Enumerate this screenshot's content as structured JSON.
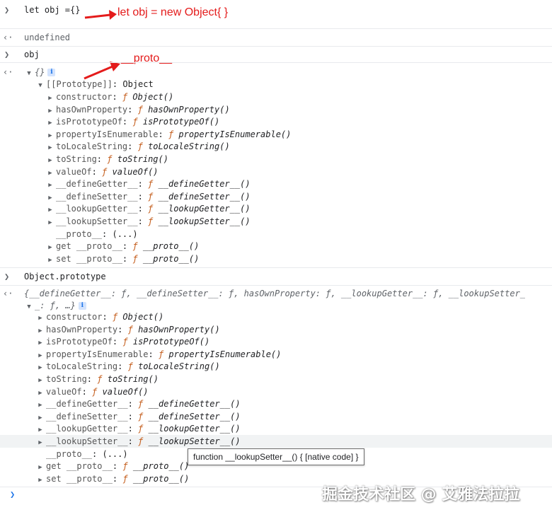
{
  "console": {
    "cmd1": "let obj ={}",
    "out1": "undefined",
    "cmd2": "obj",
    "obj_preview": "{}",
    "proto_key": "[[Prototype]]",
    "proto_val": "Object",
    "cmd3": "Object.prototype",
    "obj_proto_preview_a": "{__defineGetter__: ƒ, __defineSetter__: ƒ, hasOwnProperty: ƒ, __lookupGetter__: ƒ, __lookupSetter_",
    "obj_proto_preview_b": "_: ƒ, …}",
    "props": [
      {
        "key": "constructor",
        "fn": "Object()"
      },
      {
        "key": "hasOwnProperty",
        "fn": "hasOwnProperty()"
      },
      {
        "key": "isPrototypeOf",
        "fn": "isPrototypeOf()"
      },
      {
        "key": "propertyIsEnumerable",
        "fn": "propertyIsEnumerable()"
      },
      {
        "key": "toLocaleString",
        "fn": "toLocaleString()"
      },
      {
        "key": "toString",
        "fn": "toString()"
      },
      {
        "key": "valueOf",
        "fn": "valueOf()"
      },
      {
        "key": "__defineGetter__",
        "fn": "__defineGetter__()"
      },
      {
        "key": "__defineSetter__",
        "fn": "__defineSetter__()"
      },
      {
        "key": "__lookupGetter__",
        "fn": "__lookupGetter__()"
      },
      {
        "key": "__lookupSetter__",
        "fn": "__lookupSetter__()"
      }
    ],
    "proto_prop_key": "__proto__",
    "proto_prop_val": "(...)",
    "get_key": "get __proto__",
    "set_key": "set __proto__",
    "getset_fn": "__proto__()",
    "f_symbol": "ƒ",
    "tooltip": "function __lookupSetter__() { [native code] }"
  },
  "annotations": {
    "new_object": "let obj = new Object{ }",
    "proto": "__proto__"
  },
  "watermark": "掘金技术社区 @ 艾雅法拉拉"
}
